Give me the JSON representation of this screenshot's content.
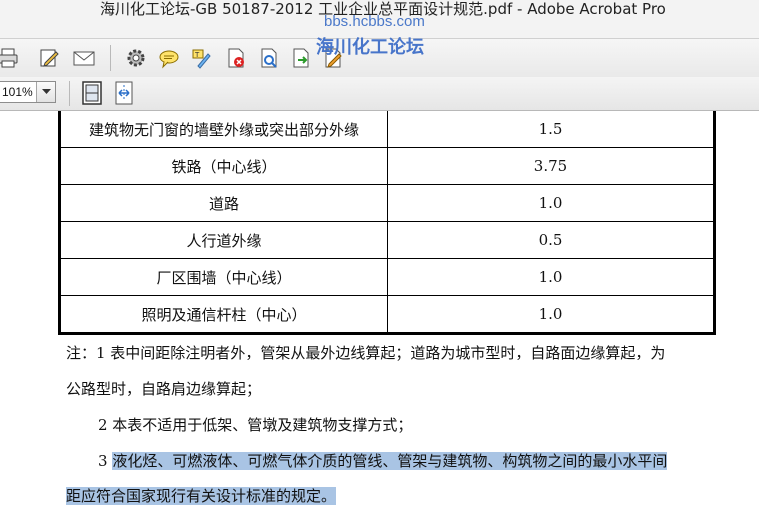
{
  "window": {
    "title": "海川化工论坛-GB 50187-2012 工业企业总平面设计规范.pdf - Adobe Acrobat Pro"
  },
  "watermark": {
    "url": "bbs.hcbbs.com",
    "name": "海川化工论坛"
  },
  "toolbar": {
    "icons": [
      "print-icon",
      "edit-icon",
      "email-icon",
      "gear-icon",
      "comment-icon",
      "highlight-text-icon",
      "delete-pdf-icon",
      "review-icon",
      "export-icon",
      "sign-icon"
    ],
    "zoom_value": "101%",
    "zoom_options_icon": "chevron-down-icon",
    "view_icons": [
      "fit-page-icon",
      "fit-width-icon"
    ]
  },
  "table": {
    "rows": [
      {
        "item": "建筑物无门窗的墙壁外缘或突出部分外缘",
        "value": "1.5"
      },
      {
        "item": "铁路（中心线）",
        "value": "3.75"
      },
      {
        "item": "道路",
        "value": "1.0"
      },
      {
        "item": "人行道外缘",
        "value": "0.5"
      },
      {
        "item": "厂区围墙（中心线）",
        "value": "1.0"
      },
      {
        "item": "照明及通信杆柱（中心）",
        "value": "1.0"
      }
    ]
  },
  "notes": {
    "n1_line1": "注：1  表中间距除注明者外，管架从最外边线算起；道路为城市型时，自路面边缘算起，为",
    "n1_line2": "公路型时，自路肩边缘算起；",
    "n2": "2  本表不适用于低架、管墩及建筑物支撑方式；",
    "n3_prefix": "3 ",
    "n3_line1": "液化烃、可燃液体、可燃气体介质的管线、管架与建筑物、构筑物之间的最小水平间",
    "n3_line2": "距应符合国家现行有关设计标准的规定。"
  },
  "colors": {
    "selection_highlight": "#a9c4e4",
    "watermark": "#3f6fc8"
  }
}
